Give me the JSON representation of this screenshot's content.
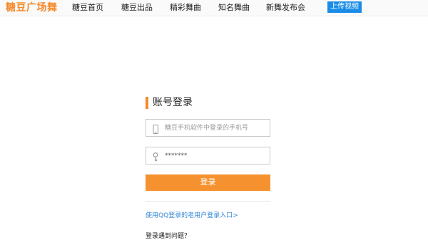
{
  "header": {
    "logo": "糖豆广场舞",
    "nav": [
      "糖豆首页",
      "糖豆出品",
      "精彩舞曲",
      "知名舞曲",
      "新舞发布会"
    ],
    "upload_label": "上传视频"
  },
  "login": {
    "title": "账号登录",
    "phone_placeholder": "糖豆手机软件中登录的手机号",
    "password_value": "*******",
    "submit_label": "登录",
    "qq_link": "使用QQ登录的老用户登录入口>",
    "help_text": "登录遇到问题？"
  },
  "colors": {
    "accent_orange": "#f5922f",
    "upload_blue": "#1a8ce8",
    "link_blue": "#2f86d6"
  },
  "icons": {
    "phone_field": "phone-icon",
    "password_field": "key-icon"
  }
}
